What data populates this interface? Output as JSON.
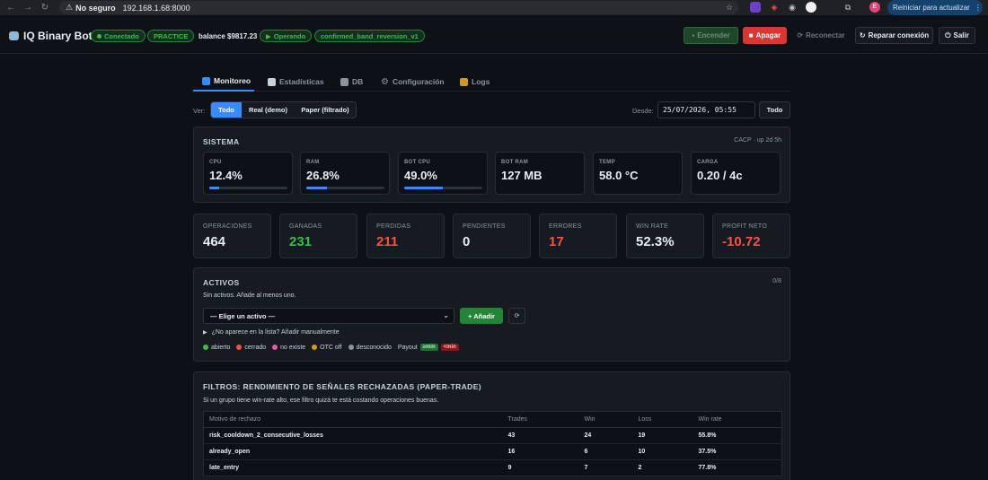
{
  "browser": {
    "security_label": "No seguro",
    "url": "192.168.1.68:8000",
    "profile_initial": "E",
    "restart_label": "Reiniciar para actualizar"
  },
  "header": {
    "brand": "IQ Binary Bot",
    "connected": "Conectado",
    "mode": "PRACTICE",
    "balance": "balance $9817.23",
    "operating": "Operando",
    "strategy": "confirmed_band_reversion_v1",
    "btn_on": "Encender",
    "btn_off": "Apagar",
    "btn_reconnect": "Reconectar",
    "btn_repair": "Reparar conexión",
    "btn_exit": "Salir"
  },
  "tabs": [
    "Monitoreo",
    "Estadísticas",
    "DB",
    "Configuración",
    "Logs"
  ],
  "filter": {
    "ver_label": "Ver:",
    "options": [
      "Todo",
      "Real (demo)",
      "Paper (filtrado)"
    ],
    "desde_label": "Desde:",
    "desde_value": "25/07/2026, 05:55",
    "todo_btn": "Todo"
  },
  "system": {
    "title": "SISTEMA",
    "meta": "CACP · up 2d 5h",
    "metrics": [
      {
        "label": "CPU",
        "value": "12.4%",
        "bar": 0.124
      },
      {
        "label": "RAM",
        "value": "26.8%",
        "bar": 0.268
      },
      {
        "label": "BOT CPU",
        "value": "49.0%",
        "bar": 0.49
      },
      {
        "label": "BOT RAM",
        "value": "127 MB"
      },
      {
        "label": "TEMP",
        "value": "58.0 °C"
      },
      {
        "label": "CARGA",
        "value": "0.20 / 4c"
      }
    ]
  },
  "stats": [
    {
      "label": "OPERACIONES",
      "value": "464",
      "color": "#e6edf3"
    },
    {
      "label": "GANADAS",
      "value": "231",
      "color": "#3fb950"
    },
    {
      "label": "PERDIDAS",
      "value": "211",
      "color": "#f85149"
    },
    {
      "label": "PENDIENTES",
      "value": "0",
      "color": "#e6edf3"
    },
    {
      "label": "ERRORES",
      "value": "17",
      "color": "#f85149"
    },
    {
      "label": "WIN RATE",
      "value": "52.3%",
      "color": "#e6edf3"
    },
    {
      "label": "PROFIT NETO",
      "value": "-10.72",
      "color": "#f85149"
    }
  ],
  "assets": {
    "title": "ACTIVOS",
    "count": "0/8",
    "empty_text": "Sin activos. Añade al menos uno.",
    "select_value": "— Elige un activo —",
    "add_button": "+ Añadir",
    "manual_link": "¿No aparece en la lista? Añadir manualmente",
    "legend": [
      {
        "label": "abierto",
        "color": "#3fb950"
      },
      {
        "label": "cerrado",
        "color": "#f85149"
      },
      {
        "label": "no existe",
        "color": "#db61a2"
      },
      {
        "label": "OTC off",
        "color": "#d29922"
      },
      {
        "label": "desconocido",
        "color": "#8b949e"
      }
    ],
    "payout_label": "Payout",
    "payout_min": "≥min",
    "payout_below": "<min"
  },
  "rejected": {
    "title": "FILTROS: RENDIMIENTO DE SEÑALES RECHAZADAS (PAPER-TRADE)",
    "subtitle": "Si un grupo tiene win-rate alto, ese filtro quizá te está costando operaciones buenas.",
    "columns": [
      "Motivo de rechazo",
      "Trades",
      "Win",
      "Loss",
      "Win rate"
    ],
    "rows": [
      [
        "risk_cooldown_2_consecutive_losses",
        "43",
        "24",
        "19",
        "55.8%"
      ],
      [
        "already_open",
        "16",
        "6",
        "10",
        "37.5%"
      ],
      [
        "late_entry",
        "9",
        "7",
        "2",
        "77.8%"
      ]
    ]
  }
}
